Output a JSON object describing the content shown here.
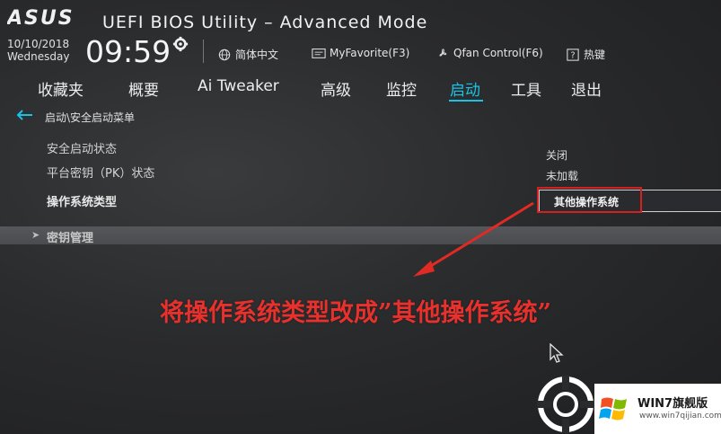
{
  "header": {
    "brand": "ASUS",
    "title": "UEFI BIOS Utility – Advanced Mode",
    "date": "10/10/2018",
    "weekday": "Wednesday",
    "time": "09:59",
    "language": "简体中文",
    "my_favorite": "MyFavorite(F3)",
    "qfan": "Qfan Control(F6)",
    "hotkey": "热键"
  },
  "tabs": [
    {
      "label": "收藏夹"
    },
    {
      "label": "概要"
    },
    {
      "label": "Ai Tweaker"
    },
    {
      "label": "高级"
    },
    {
      "label": "监控"
    },
    {
      "label": "启动",
      "active": true
    },
    {
      "label": "工具"
    },
    {
      "label": "退出"
    }
  ],
  "breadcrumb": "启动\\安全启动菜单",
  "settings": [
    {
      "label": "安全启动状态",
      "value": "关闭"
    },
    {
      "label": "平台密钥（PK）状态",
      "value": "未加载"
    },
    {
      "label": "操作系统类型",
      "value": "其他操作系统"
    }
  ],
  "submenu": "密钥管理",
  "annotation": "将操作系统类型改成”其他操作系统”",
  "watermark": {
    "title": "WIN7旗舰版",
    "url": "www.win7qijian.com"
  },
  "colors": {
    "accent": "#19c3e6",
    "annotation": "#e8312c",
    "background": "#2a2b2d"
  }
}
